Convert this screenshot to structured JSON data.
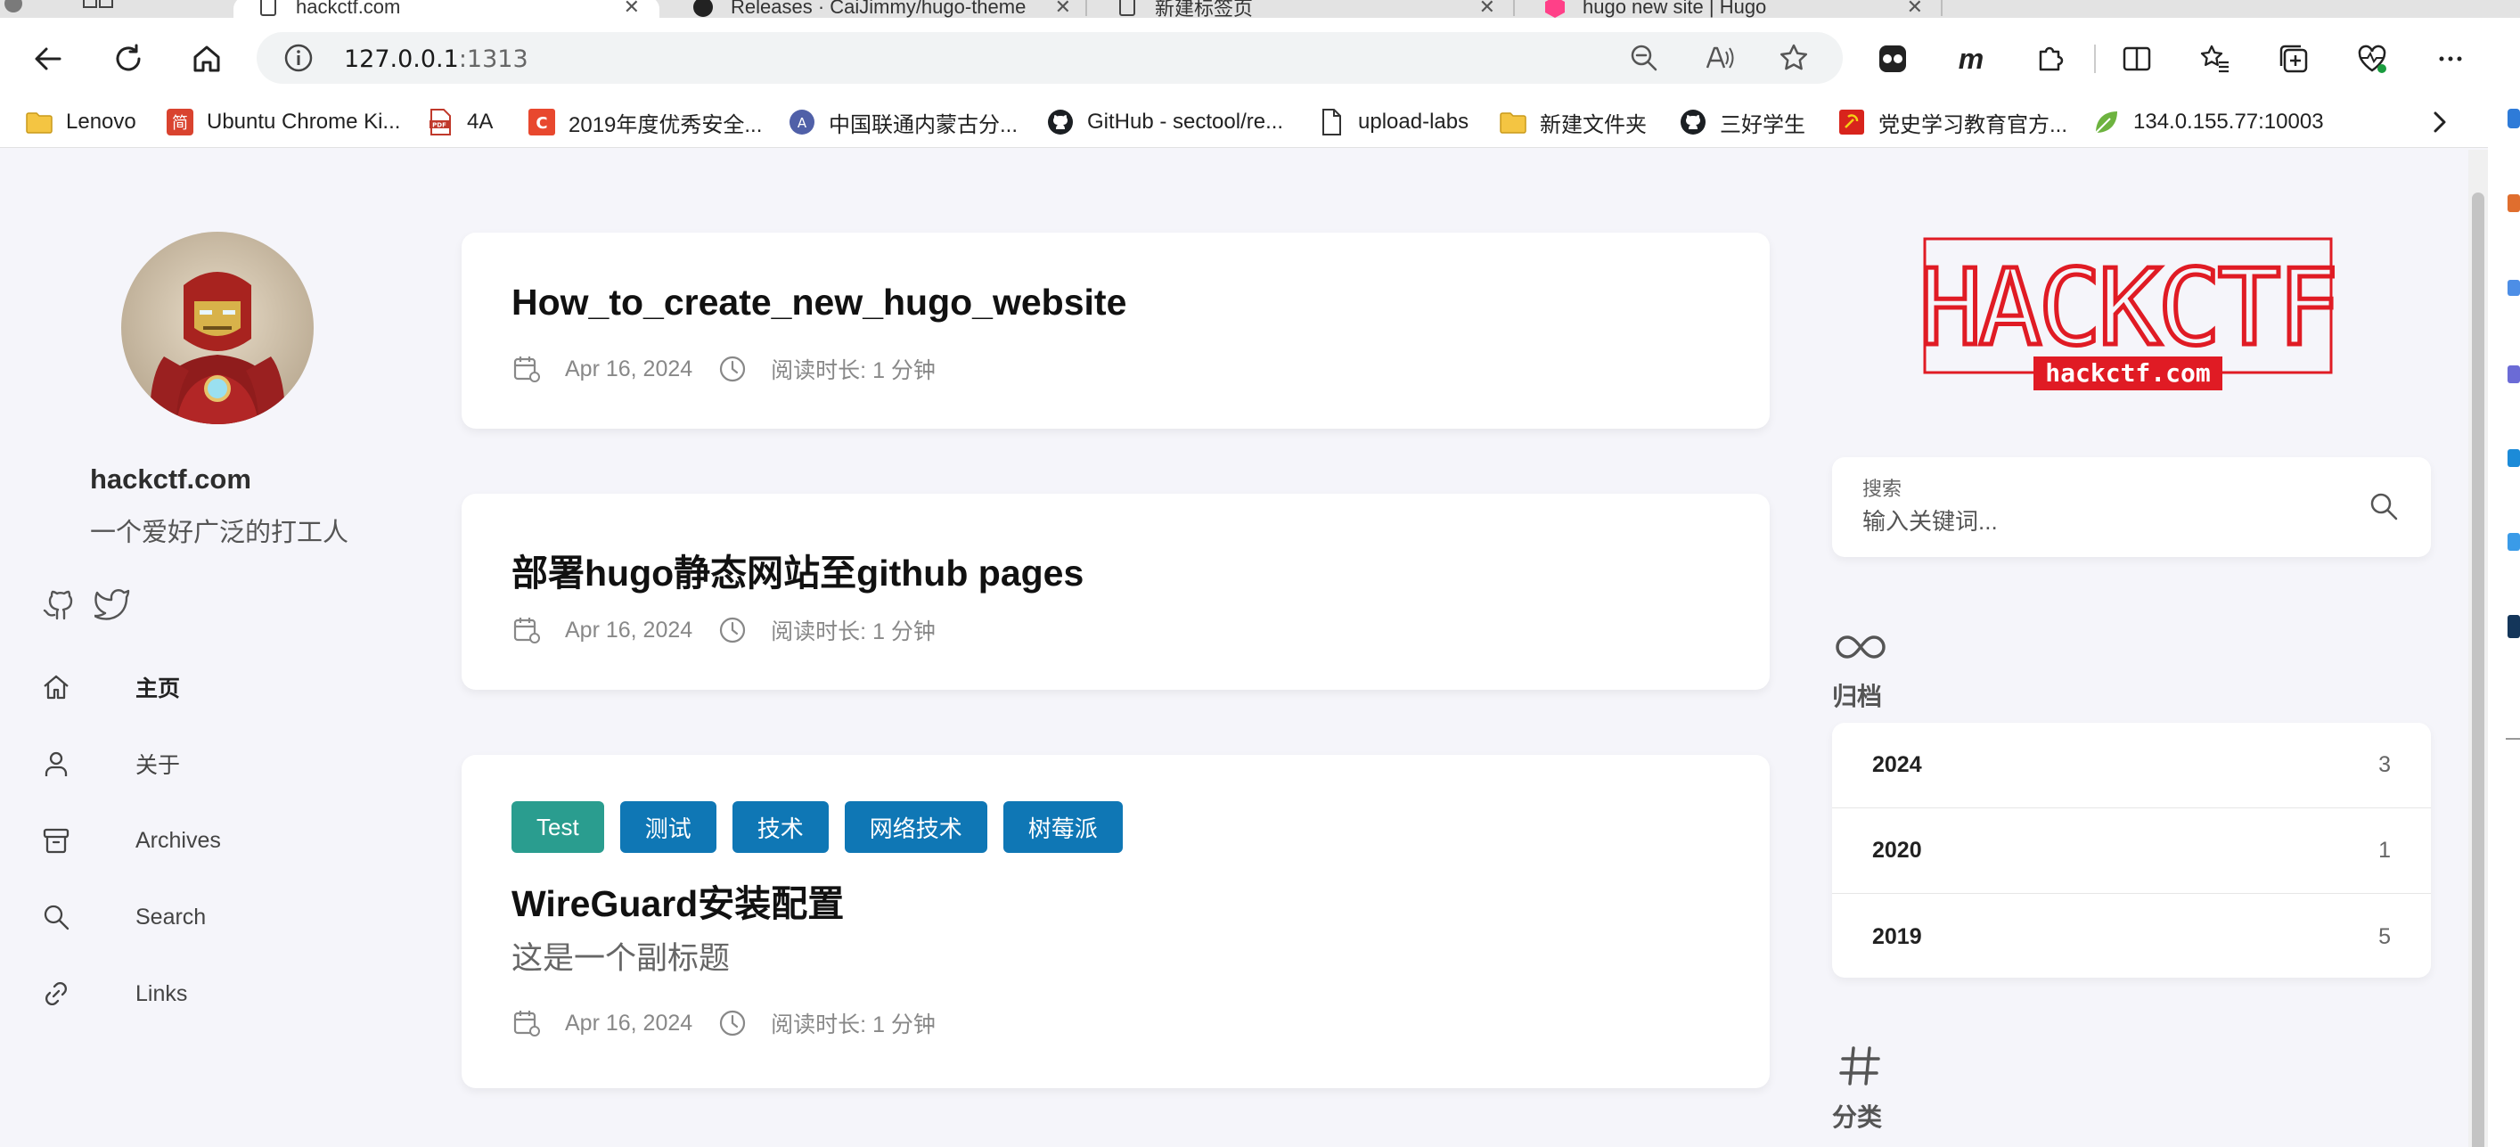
{
  "browser": {
    "tabs": [
      {
        "label": "hackctf.com"
      },
      {
        "label": "Releases · CaiJimmy/hugo-theme"
      },
      {
        "label": "新建标签页"
      },
      {
        "label": "hugo new site | Hugo"
      }
    ],
    "url_host": "127.0.0.1",
    "url_port": ":1313",
    "bookmarks": [
      {
        "label": "Lenovo",
        "icon": "folder-icon"
      },
      {
        "label": "Ubuntu Chrome Ki...",
        "icon": "site-icon",
        "badge": "简"
      },
      {
        "label": "4A",
        "icon": "pdf-icon"
      },
      {
        "label": "2019年度优秀安全...",
        "icon": "site-icon",
        "badge": "C"
      },
      {
        "label": "中国联通内蒙古分...",
        "icon": "site-icon",
        "badge": "A"
      },
      {
        "label": "GitHub - sectool/re...",
        "icon": "github-icon"
      },
      {
        "label": "upload-labs",
        "icon": "page-icon"
      },
      {
        "label": "新建文件夹",
        "icon": "folder-icon"
      },
      {
        "label": "三好学生",
        "icon": "github-icon"
      },
      {
        "label": "党史学习教育官方...",
        "icon": "site-icon"
      },
      {
        "label": "134.0.155.77:10003",
        "icon": "leaf-icon"
      }
    ]
  },
  "sidebar": {
    "site_name": "hackctf.com",
    "site_desc": "一个爱好广泛的打工人",
    "social": [
      "github-icon",
      "twitter-icon"
    ],
    "menu": [
      {
        "label": "主页",
        "icon": "home-icon",
        "active": true
      },
      {
        "label": "关于",
        "icon": "user-icon"
      },
      {
        "label": "Archives",
        "icon": "archive-icon"
      },
      {
        "label": "Search",
        "icon": "search-icon"
      },
      {
        "label": "Links",
        "icon": "link-icon"
      }
    ]
  },
  "articles": [
    {
      "title": "How_to_create_new_hugo_website",
      "date": "Apr 16, 2024",
      "reading_time": "阅读时长: 1 分钟"
    },
    {
      "title": "部署hugo静态网站至github pages",
      "date": "Apr 16, 2024",
      "reading_time": "阅读时长: 1 分钟"
    },
    {
      "tags": [
        {
          "label": "Test",
          "color": "#2a9d8f"
        },
        {
          "label": "测试",
          "color": "#0f77b5"
        },
        {
          "label": "技术",
          "color": "#0f77b5"
        },
        {
          "label": "网络技术",
          "color": "#0f77b5"
        },
        {
          "label": "树莓派",
          "color": "#0f77b5"
        }
      ],
      "title": "WireGuard安装配置",
      "subtitle": "这是一个副标题",
      "date": "Apr 16, 2024",
      "reading_time": "阅读时长: 1 分钟"
    }
  ],
  "right": {
    "logo_text": "HACKCTF",
    "logo_sub": "hackctf.com",
    "search_label": "搜索",
    "search_placeholder": "输入关键词...",
    "archive_title": "归档",
    "archives": [
      {
        "year": "2024",
        "count": "3"
      },
      {
        "year": "2020",
        "count": "1"
      },
      {
        "year": "2019",
        "count": "5"
      }
    ],
    "category_title": "分类",
    "accent": "#e01b24"
  }
}
